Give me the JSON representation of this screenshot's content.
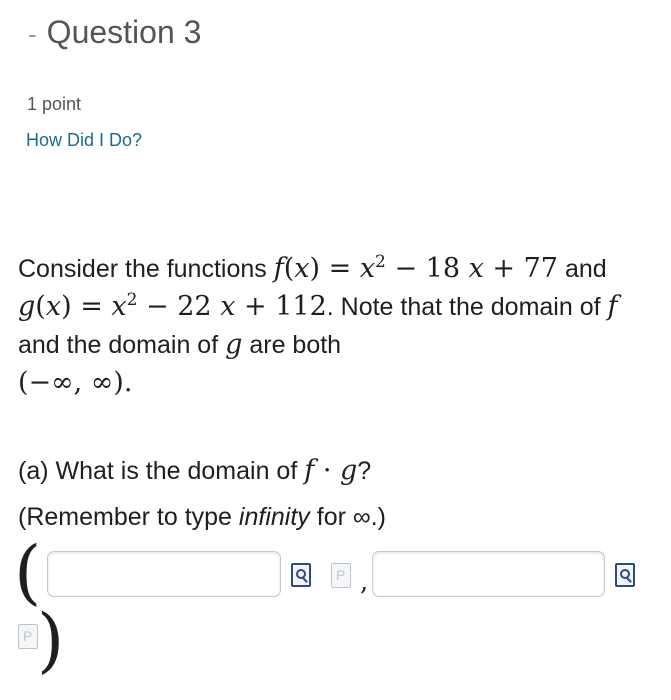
{
  "question": {
    "collapse_symbol": "-",
    "title": "Question 3",
    "points": "1 point",
    "how_did_i_do": "How Did I Do?"
  },
  "problem": {
    "t1": "Consider the functions ",
    "f_def": "f(x) = x² − 18 x + 77",
    "t2": " and ",
    "g_def": "g(x) = x² − 22 x + 112",
    "t3": ". Note that the domain of ",
    "f": "f",
    "t4": " and the domain of ",
    "g": "g",
    "t5": " are both ",
    "interval": "(−∞, ∞)",
    "t6": "."
  },
  "part_a": {
    "prefix": "(a) What is the domain of ",
    "expr": "f · g",
    "suffix": "?"
  },
  "remember": {
    "prefix": "(Remember to type ",
    "em": "infinity",
    "suffix": " for ∞.)"
  },
  "answer": {
    "left_paren": "(",
    "comma": ",",
    "right_paren": ")",
    "input1_value": "",
    "input2_value": ""
  }
}
